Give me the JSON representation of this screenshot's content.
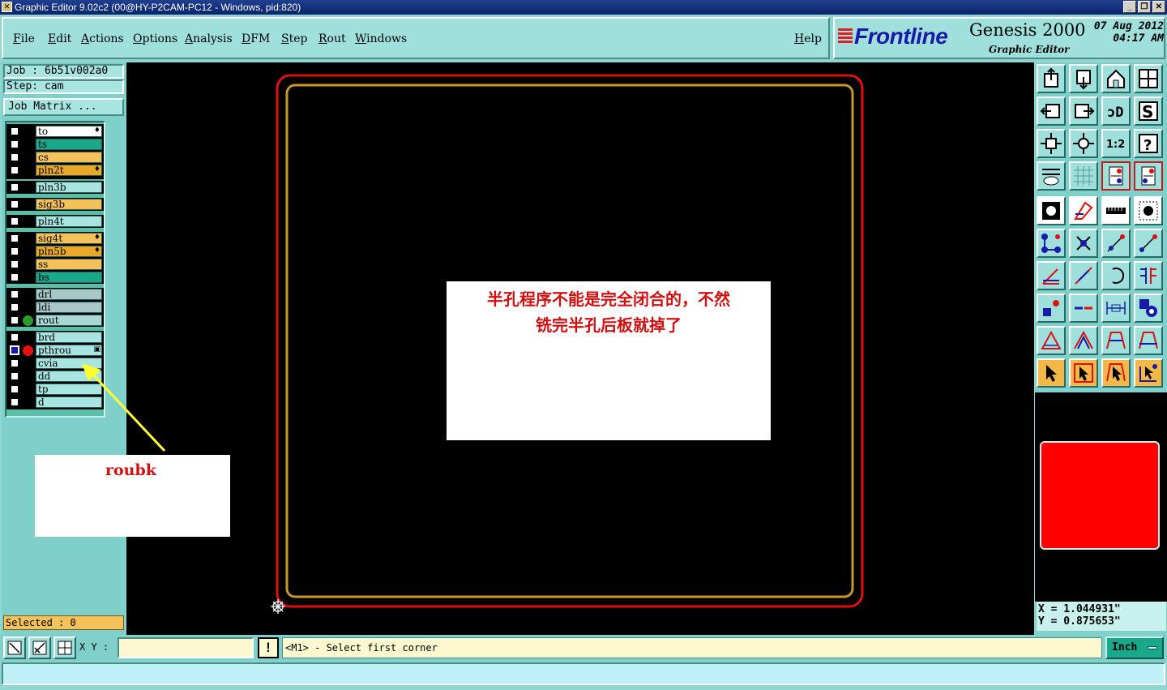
{
  "window": {
    "title": "Graphic Editor 9.02c2 (00@HY-P2CAM-PC12 - Windows, pid:820)"
  },
  "menubar": {
    "items": [
      "File",
      "Edit",
      "Actions",
      "Options",
      "Analysis",
      "DFM",
      "Step",
      "Rout",
      "Windows"
    ],
    "help": "Help"
  },
  "brand": {
    "logo": "Frontline",
    "product": "Genesis 2000",
    "subtitle": "Graphic Editor",
    "date": "07 Aug 2012",
    "time": "04:17 AM"
  },
  "job": {
    "job_line": "Job : 6b51v002a0",
    "step_line": "Step: cam",
    "matrix_button": "Job Matrix ..."
  },
  "layers": [
    {
      "name": "to",
      "color": "#ffffff",
      "mark": "♦"
    },
    {
      "name": "ts",
      "color": "#1aa88a",
      "mark": ""
    },
    {
      "name": "cs",
      "color": "#f4c15a",
      "mark": ""
    },
    {
      "name": "pln2t",
      "color": "#e8a828",
      "mark": "♦"
    },
    {
      "name": "pln3b",
      "color": "#a8e4e0",
      "mark": ""
    },
    {
      "name": "sig3b",
      "color": "#f4c15a",
      "mark": ""
    },
    {
      "name": "pln4t",
      "color": "#a8e4e0",
      "mark": ""
    },
    {
      "name": "sig4t",
      "color": "#f4c15a",
      "mark": "♦"
    },
    {
      "name": "pln5b",
      "color": "#e8a828",
      "mark": "♦"
    },
    {
      "name": "ss",
      "color": "#f4c15a",
      "mark": ""
    },
    {
      "name": "bs",
      "color": "#1aa88a",
      "mark": ""
    },
    {
      "name": "drl",
      "color": "#a8c8c8",
      "mark": ""
    },
    {
      "name": "ldi",
      "color": "#a8c8c8",
      "mark": ""
    },
    {
      "name": "rout",
      "color": "#a8d8d4",
      "mark": ""
    },
    {
      "name": "brd",
      "color": "#a8e4e0",
      "mark": ""
    },
    {
      "name": "pthrou",
      "color": "#a8e4e0",
      "mark": "▣"
    },
    {
      "name": "cvia",
      "color": "#a8e4e0",
      "mark": ""
    },
    {
      "name": "dd",
      "color": "#a8e4e0",
      "mark": ""
    },
    {
      "name": "tp",
      "color": "#a8e4e0",
      "mark": ""
    },
    {
      "name": "d",
      "color": "#a8e4e0",
      "mark": ""
    }
  ],
  "selected": "Selected : 0",
  "annotations": {
    "main_note_line1": "半孔程序不能是完全闭合的，不然",
    "main_note_line2": "铣完半孔后板就掉了",
    "side_note": "roubk"
  },
  "coords": {
    "x": "X = 1.044931\"",
    "y": "Y = 0.875653\""
  },
  "status": {
    "xy_label": "X Y :",
    "xy_value": "",
    "exclaim": "!",
    "prompt": "<M1> - Select first corner",
    "units": "Inch"
  },
  "colors": {
    "outer_outline": "#e01010",
    "inner_outline": "#c89828",
    "arrow": "#ffff30"
  }
}
